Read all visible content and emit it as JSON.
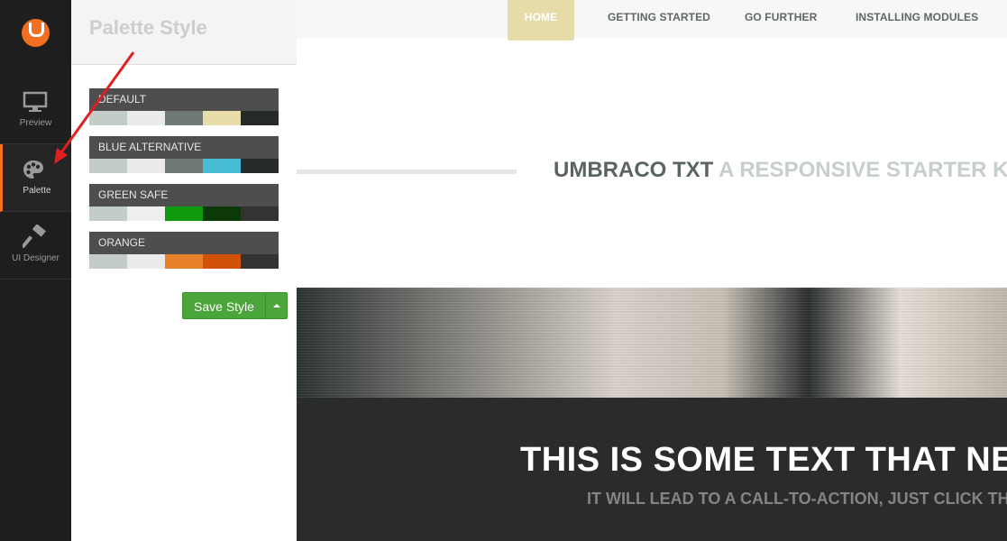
{
  "sidebar": {
    "items": [
      {
        "label": "Preview",
        "icon": "monitor-icon"
      },
      {
        "label": "Palette",
        "icon": "palette-icon"
      },
      {
        "label": "UI Designer",
        "icon": "hammer-icon"
      }
    ]
  },
  "panel": {
    "title": "Palette Style",
    "palettes": [
      {
        "name": "DEFAULT",
        "colors": [
          "#c4ccc7",
          "#e9eceb",
          "#6f7a76",
          "#e8dcaa",
          "#252a28"
        ]
      },
      {
        "name": "BLUE ALTERNATIVE",
        "colors": [
          "#c4ccc7",
          "#e9eceb",
          "#6f7a76",
          "#45bcd4",
          "#252a28"
        ]
      },
      {
        "name": "GREEN SAFE",
        "colors": [
          "#c4ccc7",
          "#eeeeee",
          "#0e9a0c",
          "#0b3a08",
          "#333333"
        ]
      },
      {
        "name": "ORANGE",
        "colors": [
          "#c4ccc7",
          "#e9eceb",
          "#e8822a",
          "#d2520a",
          "#333333"
        ]
      }
    ],
    "save_label": "Save Style"
  },
  "site": {
    "nav": [
      "HOME",
      "GETTING STARTED",
      "GO FURTHER",
      "INSTALLING MODULES"
    ],
    "tagline_bold": "UMBRACO TXT",
    "tagline_rest": " A RESPONSIVE STARTER KIT FOR U",
    "hero_heading": "THIS IS SOME TEXT THAT NEEDS",
    "hero_sub": "IT WILL LEAD TO A CALL-TO-ACTION, JUST CLICK THE BU"
  },
  "colors": {
    "accent_orange": "#f26e21",
    "save_green": "#4aa63a",
    "arrow_red": "#e02020"
  }
}
